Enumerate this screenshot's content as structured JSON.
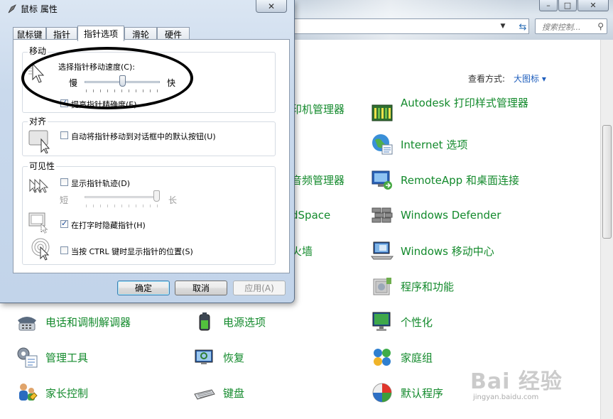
{
  "control_panel": {
    "search_placeholder": "搜索控制...",
    "view_by_label": "查看方式:",
    "view_by_value": "大图标 ▾",
    "items": [
      {
        "label": "Autodesk 打印样式管理器",
        "icon": "printer-style-icon"
      },
      {
        "label": "Internet 选项",
        "icon": "globe-icon"
      },
      {
        "label": "RemoteApp 和桌面连接",
        "icon": "remote-desktop-icon"
      },
      {
        "label": "Windows Defender",
        "icon": "defender-wall-icon"
      },
      {
        "label": "Windows 移动中心",
        "icon": "mobility-center-icon"
      },
      {
        "label": "程序和功能",
        "icon": "programs-icon"
      },
      {
        "label": "个性化",
        "icon": "personalization-icon"
      },
      {
        "label": "家庭组",
        "icon": "homegroup-icon"
      },
      {
        "label": "默认程序",
        "icon": "default-programs-icon"
      },
      {
        "label": "电话和调制解调器",
        "icon": "phone-modem-icon"
      },
      {
        "label": "管理工具",
        "icon": "admin-tools-icon"
      },
      {
        "label": "家长控制",
        "icon": "parental-controls-icon"
      },
      {
        "label": "电源选项",
        "icon": "power-options-icon"
      },
      {
        "label": "恢复",
        "icon": "recovery-icon"
      },
      {
        "label": "键盘",
        "icon": "keyboard-icon"
      },
      {
        "label": "印机管理器",
        "icon": "printer-icon"
      },
      {
        "label": "音频管理器",
        "icon": "audio-icon"
      },
      {
        "label": "dSpace",
        "icon": "dspace-icon"
      },
      {
        "label": "火墙",
        "icon": "firewall-icon"
      }
    ]
  },
  "watermark": {
    "brand": "Bai 经验",
    "url": "jingyan.baidu.com"
  },
  "dialog": {
    "title": "鼠标 属性",
    "close_glyph": "✕",
    "tabs": [
      "鼠标键",
      "指针",
      "指针选项",
      "滑轮",
      "硬件"
    ],
    "active_tab": "指针选项",
    "motion": {
      "group": "移动",
      "speed_label": "选择指针移动速度(C):",
      "slow": "慢",
      "fast": "快",
      "speed_level": 0.5,
      "precision_label": "提高指针精确度(E)",
      "precision_checked": true
    },
    "snap": {
      "group": "对齐",
      "label": "自动将指针移动到对话框中的默认按钮(U)",
      "checked": false
    },
    "visibility": {
      "group": "可见性",
      "trails_label": "显示指针轨迹(D)",
      "trails_checked": false,
      "short": "短",
      "long": "长",
      "trails_level": 1.0,
      "hide_label": "在打字时隐藏指针(H)",
      "hide_checked": true,
      "ctrl_label": "当按 CTRL 键时显示指针的位置(S)",
      "ctrl_checked": false
    },
    "buttons": {
      "ok": "确定",
      "cancel": "取消",
      "apply": "应用(A)"
    }
  }
}
